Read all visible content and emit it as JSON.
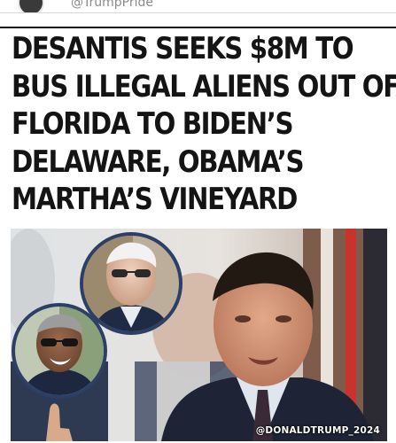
{
  "post": {
    "handle": "@TrumpPride"
  },
  "headline": {
    "lines": [
      "DESANTIS SEEKS $8M TO",
      "BUS ILLEGAL ALIENS OUT OF",
      "FLORIDA TO BIDEN’S",
      "DELAWARE, OBAMA’S",
      "MARTHA’S VINEYARD"
    ]
  },
  "photo": {
    "watermark": "@DONALDTRUMP_2024"
  }
}
